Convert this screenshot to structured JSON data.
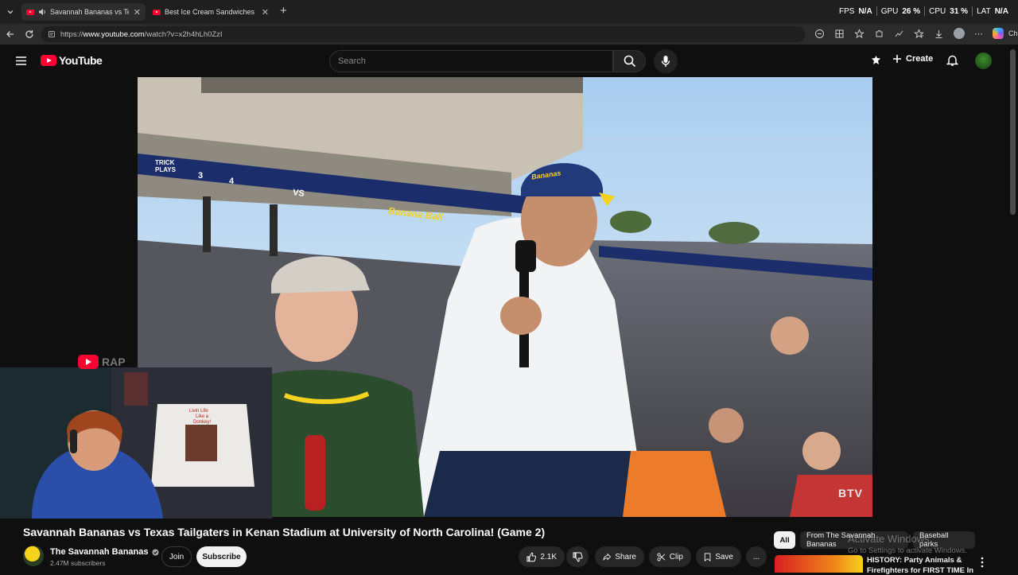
{
  "browser": {
    "tabs": [
      {
        "title": "Savannah Bananas vs Texas Tai",
        "active": true
      },
      {
        "title": "Best Ice Cream Sandwiches Comp",
        "active": false
      }
    ],
    "new_tab": "+",
    "url_prefix": "https://",
    "url_domain": "www.youtube.com",
    "url_path": "/watch?v=x2h4hLh0ZzI",
    "chat_label": "Chat"
  },
  "perf": {
    "fps_label": "FPS",
    "fps_value": "N/A",
    "gpu_label": "GPU",
    "gpu_value": "26 %",
    "cpu_label": "CPU",
    "cpu_value": "31 %",
    "lat_label": "LAT",
    "lat_value": "N/A"
  },
  "youtube": {
    "logo_text": "YouTube",
    "search_placeholder": "Search",
    "create_label": "Create"
  },
  "video": {
    "title": "Savannah Bananas vs Texas Tailgaters in Kenan Stadium at University of North Carolina! (Game 2)",
    "watermark": "BTV",
    "banner_text": "Banana Ball",
    "wall_text": "VS",
    "scoreboard_label": "TRICK PLAYS",
    "score_a": "3",
    "score_b": "4",
    "cap_text": "Bananas",
    "overlay_rap": "RAP"
  },
  "webcam": {
    "shirt_text_1": "Livin Life",
    "shirt_text_2": "Like a",
    "shirt_text_3": "Donkey!"
  },
  "channel": {
    "name": "The Savannah Bananas",
    "subscribers": "2.47M subscribers",
    "join": "Join",
    "subscribe": "Subscribe"
  },
  "actions": {
    "likes": "2.1K",
    "share": "Share",
    "clip": "Clip",
    "save": "Save",
    "more": "..."
  },
  "sidebar": {
    "chips": [
      "All",
      "From The Savannah Bananas",
      "Baseball parks"
    ],
    "activate_line1": "Activate Windows",
    "activate_line2": "Go to Settings to activate Windows.",
    "rec_title_1": "HISTORY: Party Animals &",
    "rec_title_2": "Firefighters for FIRST TIME In"
  },
  "colors": {
    "youtube_red": "#ff0033",
    "bananas_yellow": "#f5d21c",
    "stadium_navy": "#1b2d6b"
  },
  "icons": [
    "chevron-down-icon",
    "speaker-icon",
    "close-icon",
    "back-icon",
    "reload-icon",
    "hamburger-icon",
    "search-icon",
    "mic-icon",
    "create-plus-icon",
    "bell-icon",
    "like-icon",
    "dislike-icon",
    "share-icon",
    "scissors-icon",
    "bookmark-icon",
    "kebab-icon"
  ]
}
